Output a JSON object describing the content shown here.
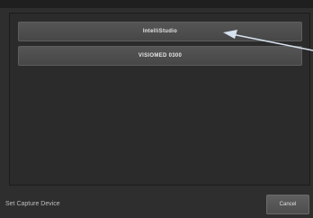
{
  "dialog": {
    "devices": [
      {
        "label": "IntelliStudio"
      },
      {
        "label": "VISIOMED 0300"
      }
    ],
    "footer_label": "Set Capture Device",
    "cancel_label": "Cancel"
  },
  "colors": {
    "background": "#2e2e2e",
    "button": "#4f4f4f",
    "text": "#e6e6e6",
    "pointer_arrow": "#c9d6e6"
  },
  "icons": {
    "pointer": "arrow-pointer-icon"
  }
}
